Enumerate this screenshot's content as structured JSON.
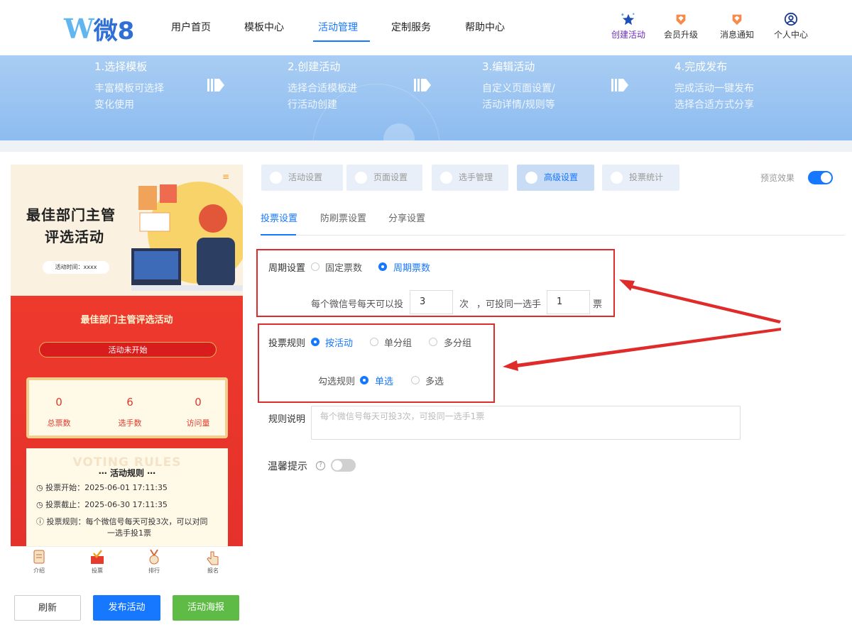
{
  "logo": {
    "brand_char": "W",
    "brand_text": "微8"
  },
  "nav": {
    "items": [
      "用户首页",
      "模板中心",
      "活动管理",
      "定制服务",
      "帮助中心"
    ],
    "active": "活动管理",
    "right": [
      {
        "label": "创建活动",
        "icon": "star-icon",
        "color": "#6a2fb6"
      },
      {
        "label": "会员升级",
        "icon": "diamond-badge-icon",
        "color": "#f07b3f"
      },
      {
        "label": "消息通知",
        "icon": "bell-badge-icon",
        "color": "#f07b3f"
      },
      {
        "label": "个人中心",
        "icon": "user-circle-icon",
        "color": "#1a3b8c"
      }
    ]
  },
  "banner": {
    "steps": [
      {
        "title": "1.选择模板",
        "desc1": "丰富模板可选择",
        "desc2": "变化使用"
      },
      {
        "title": "2.创建活动",
        "desc1": "选择合适模板进",
        "desc2": "行活动创建"
      },
      {
        "title": "3.编辑活动",
        "desc1": "自定义页面设置/",
        "desc2": "活动详情/规则等"
      },
      {
        "title": "4.完成发布",
        "desc1": "完成活动一键发布",
        "desc2": "选择合适方式分享"
      }
    ]
  },
  "phone": {
    "title_line1": "最佳部门主管",
    "title_line2": "评选活动",
    "time_pill": "活动时间：xxxx",
    "red_title": "最佳部门主管评选活动",
    "status": "活动未开始",
    "stats": [
      {
        "value": "0",
        "label": "总票数"
      },
      {
        "value": "6",
        "label": "选手数"
      },
      {
        "value": "0",
        "label": "访问量"
      }
    ],
    "voting_bg": "VOTING RULES",
    "rules_title": "活动规则",
    "rules": [
      "投票开始：2025-06-01 17:11:35",
      "投票截止：2025-06-30 17:11:35",
      "投票规则：每个微信号每天可投3次，可以对同",
      "一选手投1票"
    ],
    "tabbar": [
      "介绍",
      "投票",
      "排行",
      "报名"
    ]
  },
  "buttons": {
    "refresh": "刷新",
    "publish": "发布活动",
    "poster": "活动海报"
  },
  "settings_tabs": [
    "活动设置",
    "页面设置",
    "选手管理",
    "高级设置",
    "投票统计"
  ],
  "active_settings_tab": "高级设置",
  "preview_label": "预览效果",
  "preview_on": true,
  "subtabs": [
    "投票设置",
    "防刷票设置",
    "分享设置"
  ],
  "active_subtab": "投票设置",
  "form": {
    "period_label": "周期设置",
    "period_options": [
      "固定票数",
      "周期票数"
    ],
    "period_selected": "周期票数",
    "per_day_prefix": "每个微信号每天可以投",
    "per_day_value": "3",
    "per_day_unit": "次",
    "same_player_prefix": "，可投同一选手",
    "same_player_value": "1",
    "same_player_unit": "票",
    "rule_label": "投票规则",
    "rule_options": [
      "按活动",
      "单分组",
      "多分组"
    ],
    "rule_selected": "按活动",
    "check_label": "勾选规则",
    "check_options": [
      "单选",
      "多选"
    ],
    "check_selected": "单选",
    "desc_label": "规则说明",
    "desc_placeholder": "每个微信号每天可投3次，可投同一选手1票",
    "tips_label": "温馨提示",
    "tips_help": "?",
    "tips_on": false
  },
  "colors": {
    "accent": "#1677ff",
    "annotation": "#e02b2b",
    "publish": "#1677ff",
    "poster": "#5dbb46"
  }
}
